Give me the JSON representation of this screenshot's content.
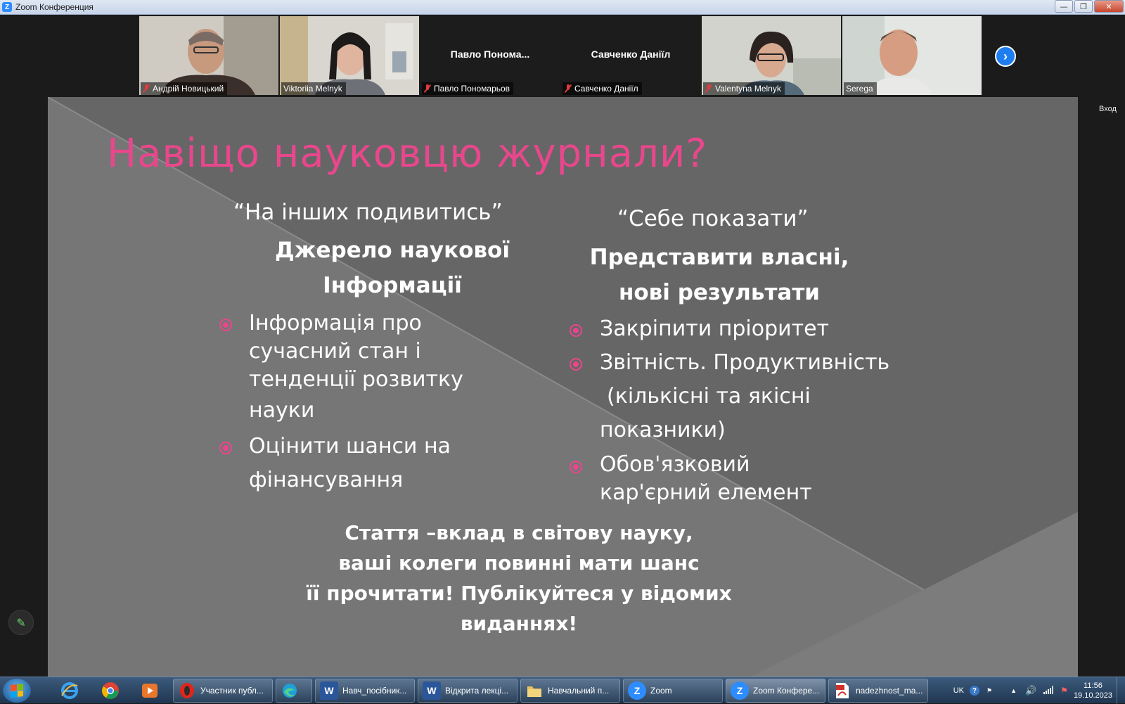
{
  "window": {
    "title": "Zoom Конференция"
  },
  "participants": [
    {
      "name": "Андрій Новицький",
      "muted": true,
      "video": true
    },
    {
      "name": "Viktoriia Melnyk",
      "muted": false,
      "video": true,
      "speaking": true
    },
    {
      "name": "Павло Пономарьов",
      "display_name": "Павло  Понома...",
      "muted": true,
      "video": false
    },
    {
      "name": "Савченко Даніїл",
      "display_name": "Савченко Даніїл",
      "muted": true,
      "video": false
    },
    {
      "name": "Valentyna Melnyk",
      "muted": true,
      "video": true
    },
    {
      "name": "Serega",
      "muted": false,
      "video": true
    }
  ],
  "side_label": "Вход",
  "slide": {
    "title": "Навіщо науковцю журнали?",
    "left": {
      "quote": "“На інших подивитись”",
      "heading_line1": "Джерело наукової",
      "heading_line2": "Інформації",
      "bullets": [
        [
          "Інформація про",
          "сучасний стан і",
          "тенденції розвитку",
          "науки"
        ],
        [
          "Оцінити шанси на",
          "фінансування"
        ]
      ]
    },
    "right": {
      "quote": "“Себе показати”",
      "heading_line1": "Представити власні,",
      "heading_line2": "нові результати",
      "bullets": [
        [
          "Закріпити пріоритет"
        ],
        [
          " Звітність. Продуктивність",
          "(кількісні та якісні",
          " показники)"
        ],
        [
          "Обов'язковий",
          "кар'єрний елемент"
        ]
      ]
    },
    "bottom": [
      "Стаття –вклад в світову науку,",
      "ваші колеги повинні мати шанс",
      "її прочитати! Публікуйтеся у відомих",
      "виданнях!"
    ],
    "colors": {
      "title": "#e8478c",
      "bullet": "#e8478c",
      "background": "#6e6e6e"
    }
  },
  "taskbar": {
    "pinned": [
      "internet-explorer-icon",
      "chrome-icon",
      "media-player-icon"
    ],
    "buttons": [
      {
        "label": "Участник публ...",
        "icon": "opera-icon"
      },
      {
        "label": "",
        "icon": "edge-icon"
      },
      {
        "label": "Навч_посібник...",
        "icon": "word-icon"
      },
      {
        "label": "Відкрита лекці...",
        "icon": "word-icon"
      },
      {
        "label": "Навчальний п...",
        "icon": "folder-icon"
      },
      {
        "label": "Zoom",
        "icon": "zoom-icon"
      },
      {
        "label": "Zoom Конфере...",
        "icon": "zoom-icon",
        "active": true
      },
      {
        "label": "nadezhnost_ma...",
        "icon": "pdf-icon"
      }
    ],
    "tray": {
      "language": "UK",
      "time": "11:56",
      "date": "19.10.2023"
    }
  }
}
